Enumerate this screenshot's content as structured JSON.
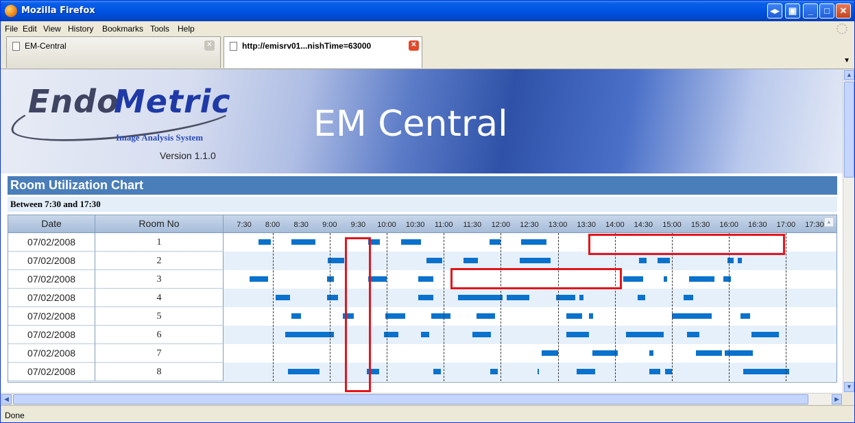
{
  "window": {
    "title": "Mozilla Firefox"
  },
  "menu": [
    "File",
    "Edit",
    "View",
    "History",
    "Bookmarks",
    "Tools",
    "Help"
  ],
  "tabs": [
    {
      "label": "EM-Central",
      "active": false
    },
    {
      "label": "http://emisrv01...nishTime=63000",
      "active": true
    }
  ],
  "banner": {
    "logo_part1": "Endo",
    "logo_part2": "Metric",
    "logo_subtitle": "Image Analysis System",
    "version": "Version 1.1.0",
    "app_title": "EM Central"
  },
  "page": {
    "section_title": "Room Utilization Chart",
    "range": "Between 7:30 and 17:30"
  },
  "table": {
    "col_date": "Date",
    "col_room": "Room No",
    "time_labels": [
      "7:30",
      "8:00",
      "8:30",
      "9:00",
      "9:30",
      "10:00",
      "10:30",
      "11:00",
      "11:30",
      "12:00",
      "12:30",
      "13:00",
      "13:30",
      "14:00",
      "14:30",
      "15:00",
      "15:30",
      "16:00",
      "16:30",
      "17:00",
      "17:30"
    ],
    "rows": [
      {
        "date": "07/02/2008",
        "room": "1",
        "bars": [
          [
            7.75,
            7.97
          ],
          [
            8.33,
            8.75
          ],
          [
            9.67,
            9.88
          ],
          [
            10.25,
            10.6
          ],
          [
            11.8,
            12.0
          ],
          [
            12.35,
            12.8
          ]
        ]
      },
      {
        "date": "07/02/2008",
        "room": "2",
        "bars": [
          [
            8.97,
            9.25
          ],
          [
            10.7,
            10.97
          ],
          [
            11.35,
            11.6
          ],
          [
            12.33,
            12.87
          ],
          [
            14.42,
            14.55
          ],
          [
            14.75,
            14.97
          ],
          [
            15.97,
            16.08
          ],
          [
            16.15,
            16.23
          ]
        ]
      },
      {
        "date": "07/02/2008",
        "room": "3",
        "bars": [
          [
            7.6,
            7.92
          ],
          [
            8.95,
            9.08
          ],
          [
            9.67,
            10.0
          ],
          [
            10.55,
            10.82
          ],
          [
            14.15,
            14.5
          ],
          [
            14.85,
            14.92
          ],
          [
            15.3,
            15.75
          ],
          [
            15.9,
            16.03
          ]
        ]
      },
      {
        "date": "07/02/2008",
        "room": "4",
        "bars": [
          [
            8.05,
            8.3
          ],
          [
            8.95,
            9.15
          ],
          [
            10.55,
            10.82
          ],
          [
            11.25,
            12.03
          ],
          [
            12.1,
            12.5
          ],
          [
            12.97,
            13.3
          ],
          [
            13.38,
            13.45
          ],
          [
            14.4,
            14.53
          ],
          [
            15.2,
            15.37
          ]
        ]
      },
      {
        "date": "07/02/2008",
        "room": "5",
        "bars": [
          [
            8.33,
            8.5
          ],
          [
            9.23,
            9.42
          ],
          [
            9.97,
            10.32
          ],
          [
            10.78,
            11.12
          ],
          [
            11.57,
            11.9
          ],
          [
            13.15,
            13.42
          ],
          [
            13.55,
            13.62
          ],
          [
            15.0,
            15.7
          ],
          [
            16.2,
            16.37
          ]
        ]
      },
      {
        "date": "07/02/2008",
        "room": "6",
        "bars": [
          [
            8.22,
            9.08
          ],
          [
            9.95,
            10.2
          ],
          [
            10.6,
            10.75
          ],
          [
            11.5,
            11.83
          ],
          [
            13.15,
            13.55
          ],
          [
            14.2,
            14.85
          ],
          [
            15.27,
            15.48
          ],
          [
            16.4,
            16.87
          ]
        ]
      },
      {
        "date": "07/02/2008",
        "room": "7",
        "bars": [
          [
            12.72,
            13.0
          ],
          [
            13.6,
            14.05
          ],
          [
            14.6,
            14.68
          ],
          [
            15.42,
            15.88
          ],
          [
            15.92,
            16.42
          ]
        ]
      },
      {
        "date": "07/02/2008",
        "room": "8",
        "bars": [
          [
            8.27,
            8.82
          ],
          [
            9.65,
            9.87
          ],
          [
            10.82,
            10.95
          ],
          [
            11.82,
            11.95
          ],
          [
            12.65,
            12.67
          ],
          [
            13.33,
            13.65
          ],
          [
            14.6,
            14.8
          ],
          [
            14.88,
            15.0
          ],
          [
            16.25,
            17.05
          ]
        ]
      }
    ]
  },
  "scrollbars": {
    "vertical": true,
    "horizontal": true
  },
  "status": "Done",
  "colors": {
    "bar": "#0a72cc",
    "highlight": "#e3141b",
    "section_header": "#4a7eb9"
  }
}
